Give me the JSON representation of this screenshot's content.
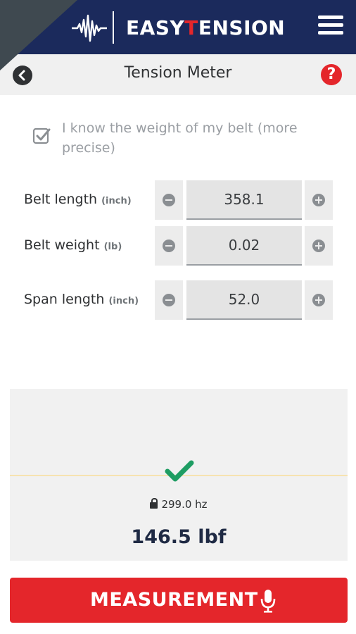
{
  "header": {
    "logo_part1": "EASY",
    "logo_accent": "T",
    "logo_part2": "ENSION",
    "menu_icon": "hamburger-menu-icon"
  },
  "titlebar": {
    "title": "Tension Meter",
    "back_icon": "back-arrow-icon",
    "help_symbol": "?"
  },
  "weight_option": {
    "label": "I know the weight of my belt (more precise)",
    "checked": true
  },
  "fields": [
    {
      "label": "Belt length",
      "unit": "(inch)",
      "value": "358.1"
    },
    {
      "label": "Belt weight",
      "unit": "(lb)",
      "value": "0.02"
    },
    {
      "label": "Span length",
      "unit": "(inch)",
      "value": "52.0"
    }
  ],
  "result": {
    "status_icon": "checkmark-icon",
    "frequency": "299.0 hz",
    "tension": "146.5 lbf"
  },
  "action": {
    "label": "MEASUREMENT",
    "icon": "microphone-icon"
  },
  "colors": {
    "brand_navy": "#1b2a5c",
    "accent_red": "#e4262b",
    "ok_green": "#1e9d63"
  }
}
